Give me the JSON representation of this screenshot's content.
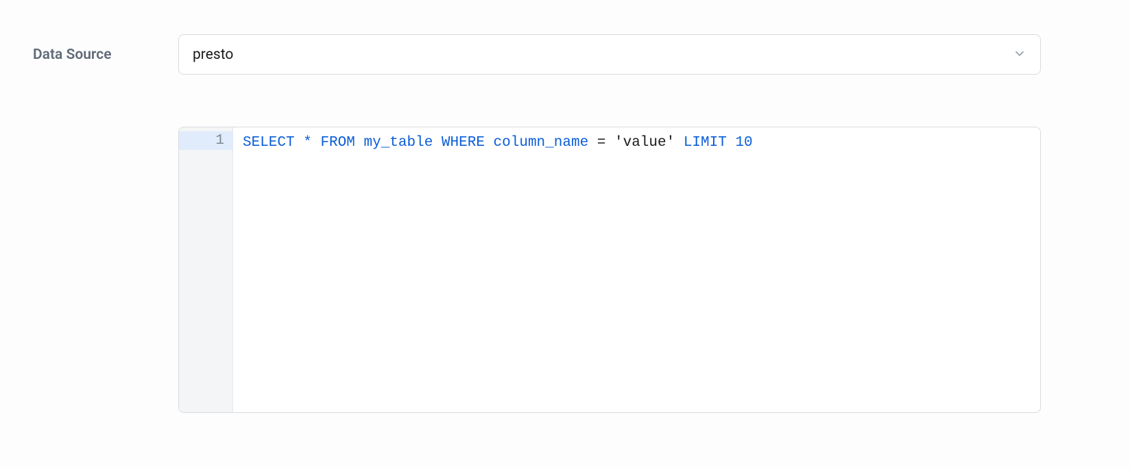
{
  "data_source": {
    "label": "Data Source",
    "selected": "presto"
  },
  "editor": {
    "line_numbers": [
      "1"
    ],
    "active_line": 1,
    "sql": {
      "raw": "SELECT * FROM my_table WHERE column_name = 'value' LIMIT 10",
      "tokens": [
        {
          "t": "kw",
          "v": "SELECT"
        },
        {
          "t": "sp",
          "v": " "
        },
        {
          "t": "kw",
          "v": "*"
        },
        {
          "t": "sp",
          "v": " "
        },
        {
          "t": "kw",
          "v": "FROM"
        },
        {
          "t": "sp",
          "v": " "
        },
        {
          "t": "id",
          "v": "my_table"
        },
        {
          "t": "sp",
          "v": " "
        },
        {
          "t": "kw",
          "v": "WHERE"
        },
        {
          "t": "sp",
          "v": " "
        },
        {
          "t": "id",
          "v": "column_name"
        },
        {
          "t": "sp",
          "v": " "
        },
        {
          "t": "op",
          "v": "="
        },
        {
          "t": "sp",
          "v": " "
        },
        {
          "t": "str",
          "v": "'value'"
        },
        {
          "t": "sp",
          "v": " "
        },
        {
          "t": "kw",
          "v": "LIMIT"
        },
        {
          "t": "sp",
          "v": " "
        },
        {
          "t": "num",
          "v": "10"
        }
      ]
    }
  }
}
